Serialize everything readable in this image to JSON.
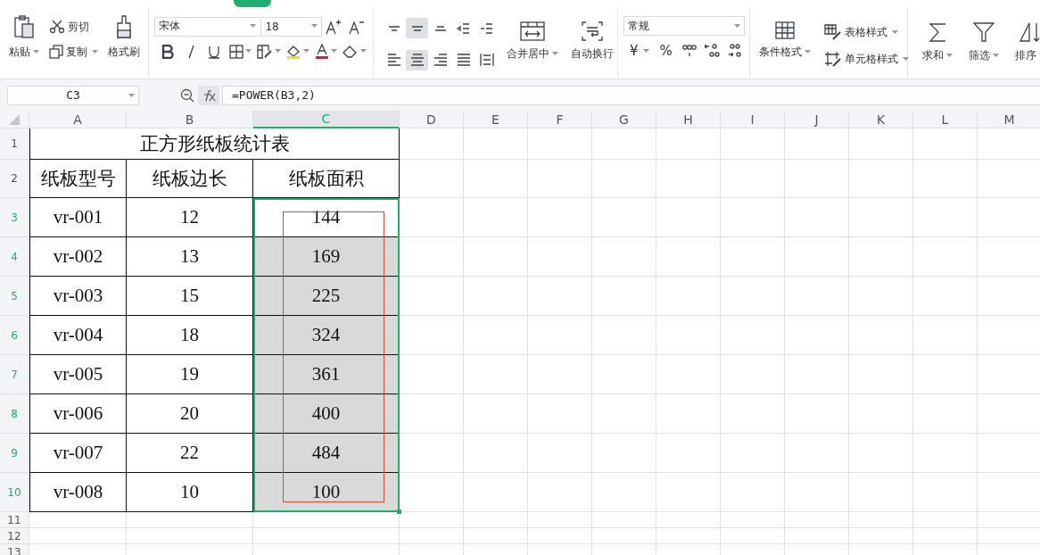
{
  "ribbon": {
    "clipboard": {
      "paste": "粘贴",
      "cut": "剪切",
      "copy": "复制",
      "painter": "格式刷"
    },
    "font": {
      "name": "宋体",
      "size": "18"
    },
    "alignment": [
      {
        "selected": false
      },
      {
        "selected": true
      },
      {
        "selected": false
      },
      {
        "selected": false
      },
      {
        "selected": false
      },
      {
        "selected": false
      },
      {
        "selected": true
      },
      {
        "selected": false
      },
      {
        "selected": false
      },
      {
        "selected": false
      }
    ],
    "merge": "合并居中",
    "wrap": "自动换行",
    "number": {
      "format": "常规",
      "currency": "¥",
      "percent": "%"
    },
    "styles": {
      "conditional": "条件格式",
      "table": "表格样式",
      "cell": "单元格样式"
    },
    "editing": [
      "求和",
      "筛选",
      "排序"
    ]
  },
  "formula_bar": {
    "name_box": "C3",
    "formula": "=POWER(B3,2)"
  },
  "sheet": {
    "columns": [
      {
        "label": "A",
        "selected": false
      },
      {
        "label": "B",
        "selected": false
      },
      {
        "label": "C",
        "selected": true
      },
      {
        "label": "D",
        "selected": false
      },
      {
        "label": "E",
        "selected": false
      },
      {
        "label": "F",
        "selected": false
      },
      {
        "label": "G",
        "selected": false
      },
      {
        "label": "H",
        "selected": false
      },
      {
        "label": "I",
        "selected": false
      },
      {
        "label": "J",
        "selected": false
      },
      {
        "label": "K",
        "selected": false
      },
      {
        "label": "L",
        "selected": false
      },
      {
        "label": "M",
        "selected": false
      }
    ],
    "rows": [
      {
        "label": "1",
        "kind": "title",
        "selected": false,
        "cells": [
          {
            "text": "正方形纸板统计表",
            "colspan": 3
          }
        ]
      },
      {
        "label": "2",
        "kind": "header",
        "selected": false,
        "cells": [
          "纸板型号",
          "纸板边长",
          "纸板面积"
        ]
      },
      {
        "label": "3",
        "kind": "data",
        "selected": true,
        "active": true,
        "cells": [
          "vr-001",
          "12",
          "144"
        ]
      },
      {
        "label": "4",
        "kind": "data",
        "selected": true,
        "active": false,
        "cells": [
          "vr-002",
          "13",
          "169"
        ]
      },
      {
        "label": "5",
        "kind": "data",
        "selected": true,
        "active": false,
        "cells": [
          "vr-003",
          "15",
          "225"
        ]
      },
      {
        "label": "6",
        "kind": "data",
        "selected": true,
        "active": false,
        "cells": [
          "vr-004",
          "18",
          "324"
        ]
      },
      {
        "label": "7",
        "kind": "data",
        "selected": true,
        "active": false,
        "cells": [
          "vr-005",
          "19",
          "361"
        ]
      },
      {
        "label": "8",
        "kind": "data",
        "selected": true,
        "active": false,
        "cells": [
          "vr-006",
          "20",
          "400"
        ]
      },
      {
        "label": "9",
        "kind": "data",
        "selected": true,
        "active": false,
        "cells": [
          "vr-007",
          "22",
          "484"
        ]
      },
      {
        "label": "10",
        "kind": "data",
        "selected": true,
        "active": false,
        "cells": [
          "vr-008",
          "10",
          "100"
        ]
      },
      {
        "label": "11",
        "kind": "empty",
        "selected": false,
        "cells": []
      },
      {
        "label": "12",
        "kind": "empty",
        "selected": false,
        "cells": []
      },
      {
        "label": "13",
        "kind": "empty",
        "selected": false,
        "cells": []
      }
    ]
  }
}
